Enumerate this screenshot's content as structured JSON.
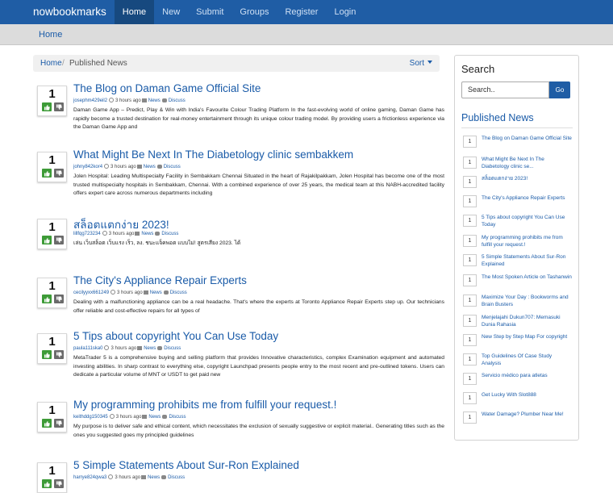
{
  "navbar": {
    "brand": "nowbookmarks",
    "links": [
      "Home",
      "New",
      "Submit",
      "Groups",
      "Register",
      "Login"
    ]
  },
  "top_breadcrumb": "Home",
  "breadcrumb": {
    "home": "Home",
    "separator": "/",
    "current": "Published News",
    "sort": "Sort"
  },
  "posts": [
    {
      "votes": "1",
      "title": "The Blog on Daman Game Official Site",
      "user": "josephm429eil2",
      "time": "3 hours ago",
      "category": "News",
      "discuss": "Discuss",
      "desc": "Daman Game App – Predict, Play & Win with India's Favourite Colour Trading Platform In the fast-evolving world of online gaming, Daman Game has rapidly become a trusted destination for real-money entertainment through its unique colour trading model. By providing users a frictionless experience via the Daman Game App and"
    },
    {
      "votes": "1",
      "title": "What Might Be Next In The Diabetology clinic sembakkem",
      "user": "johny842kor4",
      "time": "3 hours ago",
      "category": "News",
      "discuss": "Discuss",
      "desc": "Jolen Hospital: Leading Multispecialty Facility in Sembakkam Chennai Situated in the heart of Rajakilpakkam, Jolen Hospital has become one of the most trusted multispecialty hospitals in Sembakkam, Chennai. With a combined experience of over 25 years, the medical team at this NABH-accredited facility offers expert care across numerous departments including"
    },
    {
      "votes": "1",
      "title": "สล็อตแตกง่าย 2023!",
      "user": "lillfqg723234",
      "time": "3 hours ago",
      "category": "News",
      "discuss": "Discuss",
      "desc": "เล่น เว็บสล็อต เว็บแรง เร็ว, ลง. ชนะแจ็คพอต แบบไม่! สูตรเสียง 2023. ได้"
    },
    {
      "votes": "1",
      "title": "The City's Appliance Repair Experts",
      "user": "cecilyyxx661249",
      "time": "3 hours ago",
      "category": "News",
      "discuss": "Discuss",
      "desc": "Dealing with a malfunctioning appliance can be a real headache. That's where the experts at Toronto Appliance Repair Experts step up. Our technicians offer reliable and cost-effective repairs for all types of"
    },
    {
      "votes": "1",
      "title": "5 Tips about copyright You Can Use Today",
      "user": "paula111ska0",
      "time": "3 hours ago",
      "category": "News",
      "discuss": "Discuss",
      "desc": "MetaTrader 5 is a comprehensive buying and selling platform that provides Innovative characteristics, complex Examination equipment and automated investing abilities. In sharp contrast to everything else, copyright Launchpad presents people entry to the most recent and pre-outlined tokens. Users can dedicate a particular volume of MNT or USDT to get paid new"
    },
    {
      "votes": "1",
      "title": "My programming prohibits me from fulfill your request.!",
      "user": "keithddg150345",
      "time": "3 hours ago",
      "category": "News",
      "discuss": "Discuss",
      "desc": "My purpose is to deliver safe and ethical content, which necessitates the exclusion of sexually suggestive or explicit material.. Generating titles such as the ones you suggested goes my principled guidelines"
    },
    {
      "votes": "1",
      "title": "5 Simple Statements About Sur-Ron Explained",
      "user": "harrye824qwa3",
      "time": "3 hours ago",
      "category": "News",
      "discuss": "Discuss",
      "desc": ""
    }
  ],
  "sidebar": {
    "search_heading": "Search",
    "search_placeholder": "Search..",
    "search_button": "Go",
    "published_heading": "Published News",
    "items": [
      {
        "count": "1",
        "title": "The Blog on Daman Game Official Site"
      },
      {
        "count": "1",
        "title": "What Might Be Next In The Diabetology clinic se..."
      },
      {
        "count": "1",
        "title": "สล็อตแตกง่าย 2023!"
      },
      {
        "count": "1",
        "title": "The City's Appliance Repair Experts"
      },
      {
        "count": "1",
        "title": "5 Tips about copyright You Can Use Today"
      },
      {
        "count": "1",
        "title": "My programming prohibits me from fulfill your request.!"
      },
      {
        "count": "1",
        "title": "5 Simple Statements About Sur-Ron Explained"
      },
      {
        "count": "1",
        "title": "The Most Spoken Article on Tashanwin"
      },
      {
        "count": "1",
        "title": "Maximize Your Day : Bookworms and Brain Busters"
      },
      {
        "count": "1",
        "title": "Menjelajahi Dukun707: Memasuki Dunia Rahasia"
      },
      {
        "count": "1",
        "title": "New Step by Step Map For copyright"
      },
      {
        "count": "1",
        "title": "Top Guidelines Of Case Study Analysis"
      },
      {
        "count": "1",
        "title": "Servicio médico para atletas"
      },
      {
        "count": "1",
        "title": "Get Lucky With Slot888"
      },
      {
        "count": "1",
        "title": "Water Damage? Plumber Near Me!"
      }
    ]
  },
  "colors": {
    "navbar": "#1f5da5",
    "link": "#1a5ba8",
    "upvote": "#3d9b37",
    "downvote": "#6b6b6b"
  },
  "icons": [
    "thumbs-up-icon",
    "thumbs-down-icon",
    "clock-icon",
    "folder-icon",
    "comments-icon",
    "caret-down-icon"
  ]
}
